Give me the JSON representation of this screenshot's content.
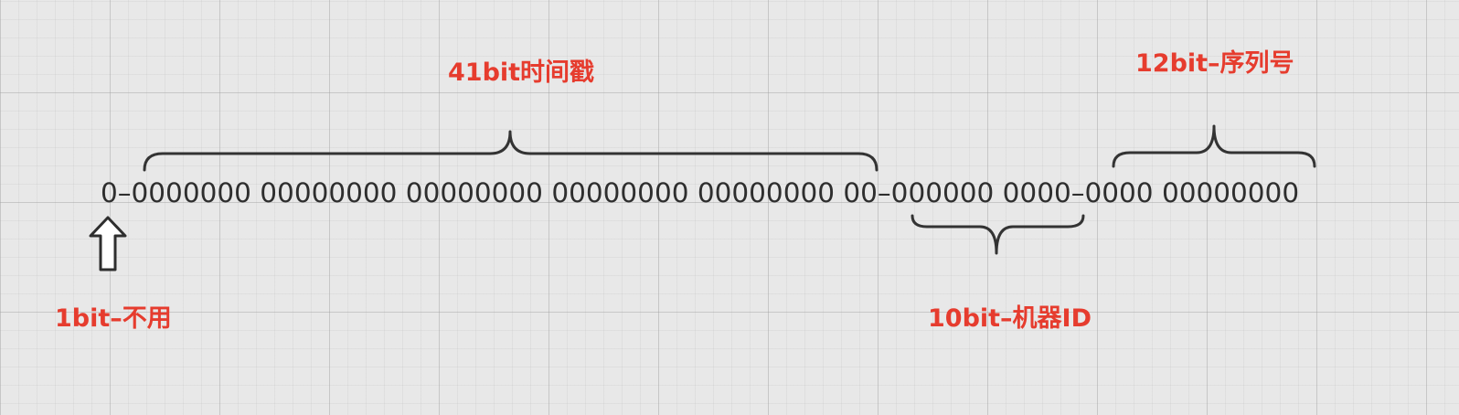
{
  "diagram": {
    "bit_string": "0–0000000 00000000 00000000 00000000 00000000 00–000000 0000–0000 00000000",
    "labels": {
      "sign": "1bit–不用",
      "timestamp": "41bit时间戳",
      "machine_id": "10bit–机器ID",
      "sequence": "12bit–序列号"
    },
    "colors": {
      "label": "#e63c2e",
      "bits": "#2e2e2e",
      "brace": "#333333",
      "background": "#e8e8e8"
    },
    "icons": {
      "sign_pointer": "up-arrow-icon"
    }
  }
}
